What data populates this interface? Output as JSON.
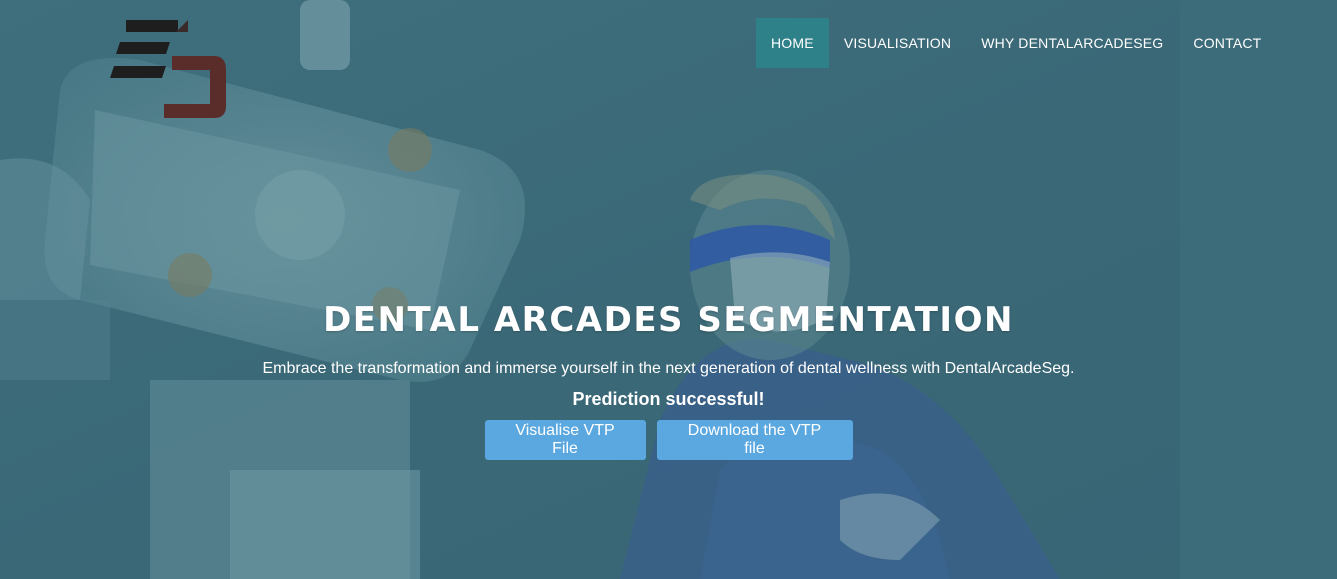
{
  "brand": {
    "logo_icon": "dental-arcade-seg-logo-icon",
    "logo_colors": [
      "#1e1e1e",
      "#5a2d2a"
    ]
  },
  "nav": {
    "items": [
      {
        "label": "HOME",
        "active": true
      },
      {
        "label": "VISUALISATION",
        "active": false
      },
      {
        "label": "WHY DENTALARCADESEG",
        "active": false
      },
      {
        "label": "CONTACT",
        "active": false
      }
    ]
  },
  "hero": {
    "title": "DENTAL ARCADES SEGMENTATION",
    "subtitle": "Embrace the transformation and immerse yourself in the next generation of dental wellness with DentalArcadeSeg.",
    "status": "Prediction successful!",
    "buttons": {
      "visualise_label": "Visualise VTP File",
      "download_label": "Download the VTP file"
    }
  },
  "colors": {
    "overlay": "#3b6a78",
    "nav_active": "#2e8089",
    "button": "#5ba8e0"
  }
}
